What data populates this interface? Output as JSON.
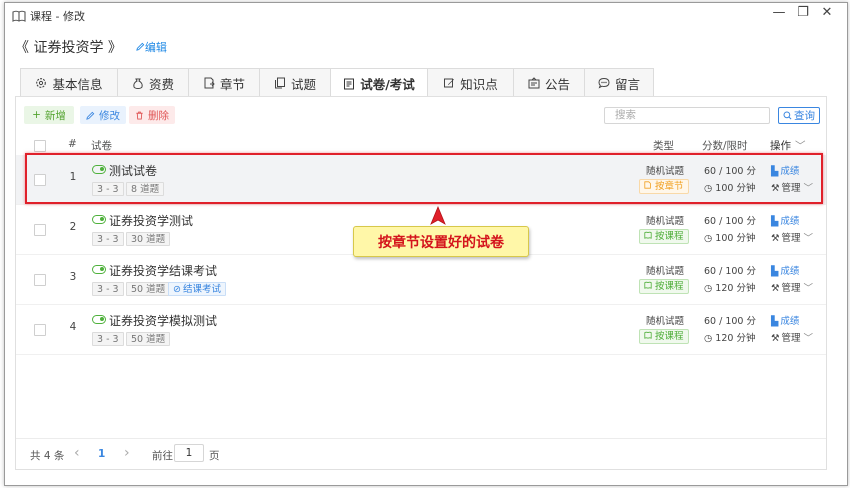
{
  "window": {
    "title": "课程 - 修改",
    "controls": {
      "minimize": "—",
      "restore": "❐",
      "close": "✕"
    }
  },
  "header": {
    "course_title": "《 证券投资学 》",
    "edit_label": "编辑"
  },
  "tabs": [
    {
      "label": "基本信息",
      "icon": "gear-icon"
    },
    {
      "label": "资费",
      "icon": "money-bag-icon"
    },
    {
      "label": "章节",
      "icon": "chapter-icon"
    },
    {
      "label": "试题",
      "icon": "copy-icon"
    },
    {
      "label": "试卷/考试",
      "icon": "paper-icon",
      "active": true
    },
    {
      "label": "知识点",
      "icon": "pen-icon"
    },
    {
      "label": "公告",
      "icon": "notice-icon"
    },
    {
      "label": "留言",
      "icon": "chat-icon"
    }
  ],
  "toolbar": {
    "add_label": "新增",
    "edit_label": "修改",
    "delete_label": "删除",
    "search_placeholder": "搜索",
    "query_label": "查询"
  },
  "table": {
    "headers": {
      "index": "#",
      "name": "试卷",
      "type": "类型",
      "score": "分数/限时",
      "actions": "操作"
    },
    "rows": [
      {
        "index": "1",
        "name": "测试试卷",
        "tags": [
          "3 - 3",
          "8 道题"
        ],
        "type": "随机试题",
        "badge": "按章节",
        "score": "60 / 100 分",
        "time": "100 分钟",
        "result": "成绩",
        "manage": "管理"
      },
      {
        "index": "2",
        "name": "证券投资学测试",
        "tags": [
          "3 - 3",
          "30 道题"
        ],
        "type": "随机试题",
        "badge": "按课程",
        "score": "60 / 100 分",
        "time": "100 分钟",
        "result": "成绩",
        "manage": "管理"
      },
      {
        "index": "3",
        "name": "证券投资学结课考试",
        "tags": [
          "3 - 3",
          "50 道题",
          "结课考试"
        ],
        "type": "随机试题",
        "badge": "按课程",
        "score": "60 / 100 分",
        "time": "120 分钟",
        "result": "成绩",
        "manage": "管理"
      },
      {
        "index": "4",
        "name": "证券投资学模拟测试",
        "tags": [
          "3 - 3",
          "50 道题"
        ],
        "type": "随机试题",
        "badge": "按课程",
        "score": "60 / 100 分",
        "time": "120 分钟",
        "result": "成绩",
        "manage": "管理"
      }
    ]
  },
  "callout": "按章节设置好的试卷",
  "pager": {
    "total": "共 4 条",
    "prev": "‹",
    "page": "1",
    "next": "›",
    "goto_label": "前往",
    "goto_value": "1",
    "page_suffix": "页"
  },
  "colors": {
    "accent": "#3a86e0",
    "highlight": "#e0202a",
    "callout_bg": "#fff7a8",
    "callout_text": "#d4141c"
  }
}
